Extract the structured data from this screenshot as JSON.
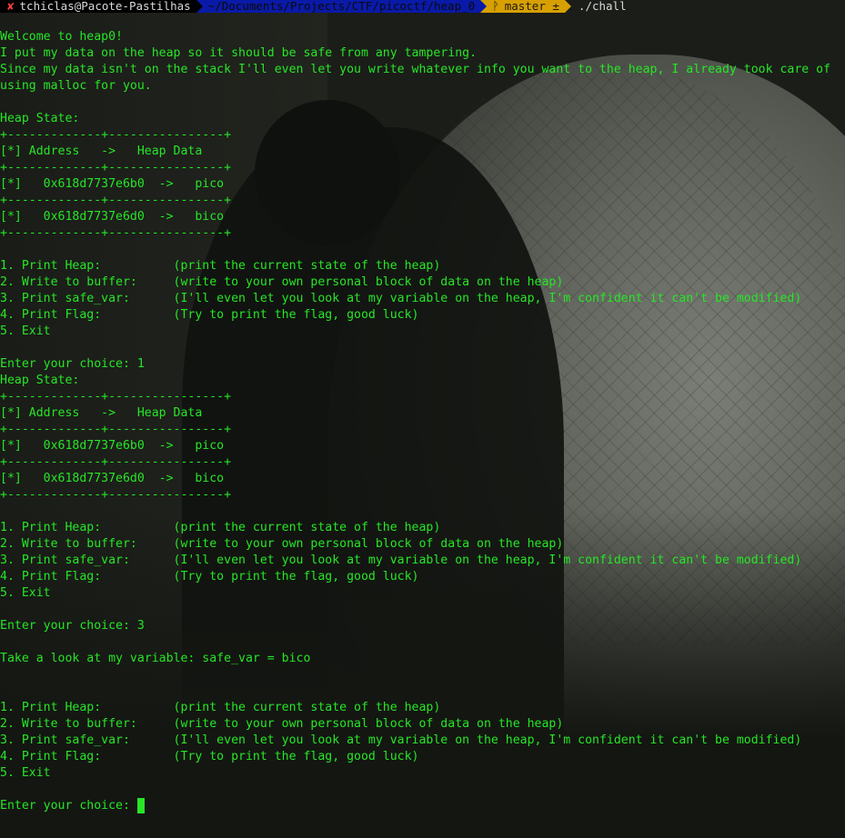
{
  "prompt": {
    "user_host": "tchiclas@Pacote-Pastilhas",
    "path": "~/Documents/Projects/CTF/picoctf/heap_0",
    "git_icon": "branch-icon",
    "git_branch": "master ±",
    "command": "./chall"
  },
  "terminal": {
    "lines": [
      "Welcome to heap0!",
      "I put my data on the heap so it should be safe from any tampering.",
      "Since my data isn't on the stack I'll even let you write whatever info you want to the heap, I already took care of",
      "using malloc for you.",
      "",
      "Heap State:",
      "+-------------+----------------+",
      "[*] Address   ->   Heap Data",
      "+-------------+----------------+",
      "[*]   0x618d7737e6b0  ->   pico",
      "+-------------+----------------+",
      "[*]   0x618d7737e6d0  ->   bico",
      "+-------------+----------------+",
      "",
      "1. Print Heap:          (print the current state of the heap)",
      "2. Write to buffer:     (write to your own personal block of data on the heap)",
      "3. Print safe_var:      (I'll even let you look at my variable on the heap, I'm confident it can't be modified)",
      "4. Print Flag:          (Try to print the flag, good luck)",
      "5. Exit",
      "",
      "Enter your choice: 1",
      "Heap State:",
      "+-------------+----------------+",
      "[*] Address   ->   Heap Data",
      "+-------------+----------------+",
      "[*]   0x618d7737e6b0  ->   pico",
      "+-------------+----------------+",
      "[*]   0x618d7737e6d0  ->   bico",
      "+-------------+----------------+",
      "",
      "1. Print Heap:          (print the current state of the heap)",
      "2. Write to buffer:     (write to your own personal block of data on the heap)",
      "3. Print safe_var:      (I'll even let you look at my variable on the heap, I'm confident it can't be modified)",
      "4. Print Flag:          (Try to print the flag, good luck)",
      "5. Exit",
      "",
      "Enter your choice: 3",
      "",
      "Take a look at my variable: safe_var = bico",
      "",
      "",
      "1. Print Heap:          (print the current state of the heap)",
      "2. Write to buffer:     (write to your own personal block of data on the heap)",
      "3. Print safe_var:      (I'll even let you look at my variable on the heap, I'm confident it can't be modified)",
      "4. Print Flag:          (Try to print the flag, good luck)",
      "5. Exit",
      ""
    ],
    "input_prompt": "Enter your choice: "
  },
  "colors": {
    "text": "#26e626",
    "path_segment": "#0a1aa8",
    "git_segment": "#d7a000",
    "error_mark": "#ff4040"
  }
}
